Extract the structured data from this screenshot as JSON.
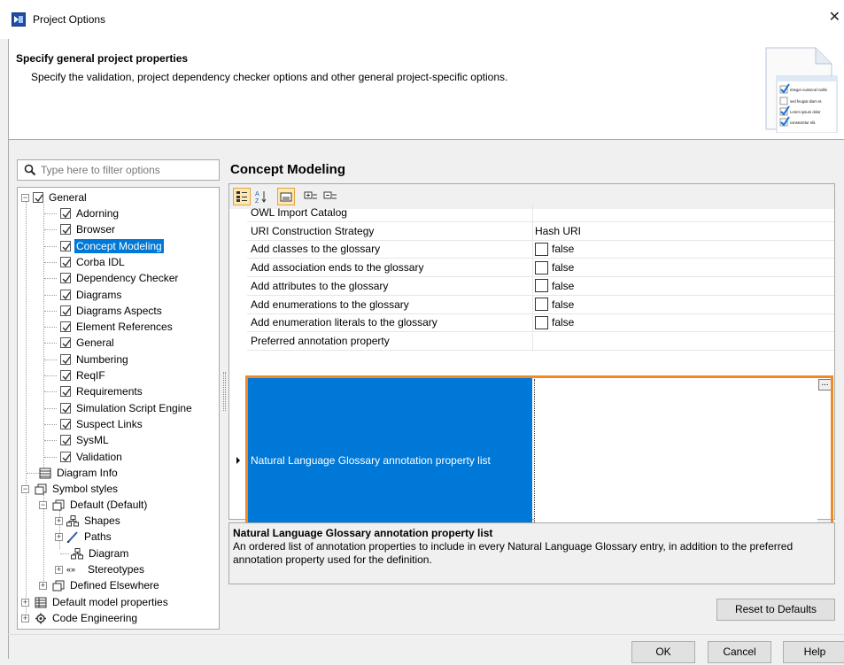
{
  "window": {
    "title": "Project Options",
    "close_glyph": "✕"
  },
  "header": {
    "title": "Specify general project properties",
    "subtitle": "Specify the validation, project dependency checker options and other general project-specific options.",
    "illustration_items": [
      "Integer euismod mollis",
      "sed feugiat diam et.",
      "Lorem ipsum dolor",
      "consectetur elit."
    ]
  },
  "filter": {
    "placeholder": "Type here to filter options",
    "value": ""
  },
  "tree": {
    "general": "General",
    "general_children": [
      "Adorning",
      "Browser",
      "Concept Modeling",
      "Corba IDL",
      "Dependency Checker",
      "Diagrams",
      "Diagrams Aspects",
      "Element References",
      "General",
      "Numbering",
      "ReqIF",
      "Requirements",
      "Simulation Script Engine",
      "Suspect Links",
      "SysML",
      "Validation"
    ],
    "selected": "Concept Modeling",
    "diagram_info": "Diagram Info",
    "symbol_styles": "Symbol styles",
    "default_default": "Default (Default)",
    "shapes": "Shapes",
    "paths": "Paths",
    "diagram": "Diagram",
    "stereotypes": "Stereotypes",
    "defined_elsewhere": "Defined Elsewhere",
    "default_model_properties": "Default model properties",
    "code_engineering": "Code Engineering"
  },
  "section": {
    "title": "Concept Modeling"
  },
  "toolbar": {
    "buttons": [
      "categorized-view-icon",
      "sort-alphabetically-icon",
      "show-descriptions-icon",
      "expand-all-icon",
      "collapse-all-icon"
    ]
  },
  "properties": [
    {
      "name": "OWL Import Catalog",
      "value": "",
      "checkbox": false
    },
    {
      "name": "URI Construction Strategy",
      "value": "Hash URI",
      "checkbox": false
    },
    {
      "name": "Add classes to the glossary",
      "value": "false",
      "checkbox": true
    },
    {
      "name": "Add association ends to the glossary",
      "value": "false",
      "checkbox": true
    },
    {
      "name": "Add attributes to the glossary",
      "value": "false",
      "checkbox": true
    },
    {
      "name": "Add enumerations to the glossary",
      "value": "false",
      "checkbox": true
    },
    {
      "name": "Add enumeration literals to the glossary",
      "value": "false",
      "checkbox": true
    },
    {
      "name": "Preferred annotation property",
      "value": "",
      "checkbox": false
    }
  ],
  "selected_property": {
    "name": "Natural Language Glossary annotation property list",
    "value": "",
    "ellipsis": "..."
  },
  "description": {
    "title": "Natural Language Glossary annotation property list",
    "text": "An ordered list of annotation properties to include in every Natural Language Glossary entry, in addition to the preferred annotation property used for the definition."
  },
  "buttons": {
    "reset": "Reset to Defaults",
    "ok": "OK",
    "cancel": "Cancel",
    "help": "Help"
  },
  "colors": {
    "selection": "#0078d7",
    "focus_border": "#f08a24"
  }
}
